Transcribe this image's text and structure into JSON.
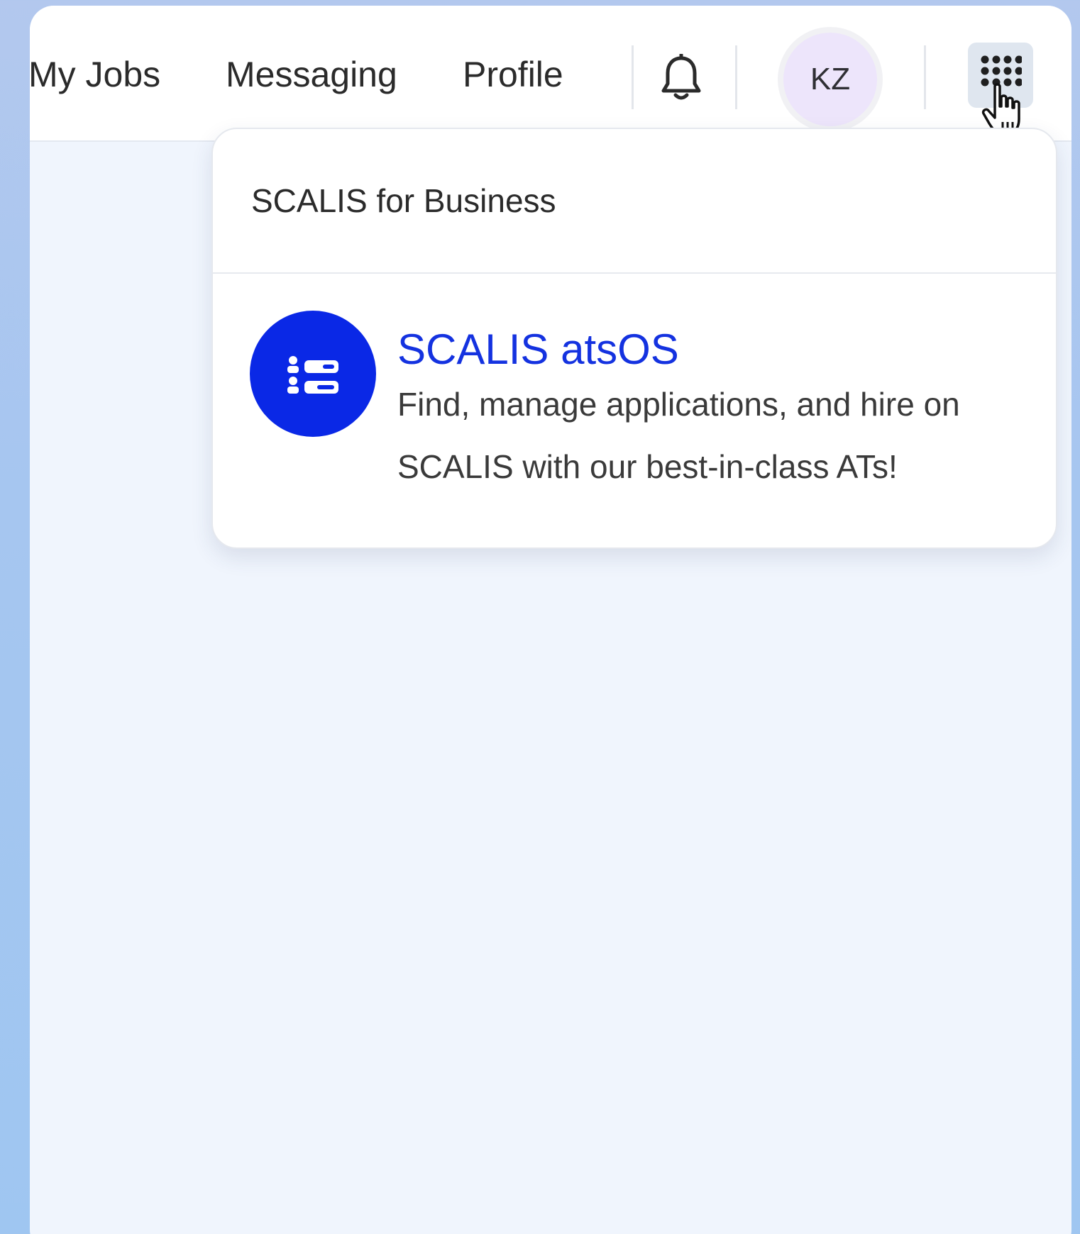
{
  "nav": {
    "items": [
      {
        "label": "My Jobs"
      },
      {
        "label": "Messaging"
      },
      {
        "label": "Profile"
      }
    ]
  },
  "user": {
    "initials": "KZ"
  },
  "icons": {
    "notifications": "bell-icon",
    "apps": "grid-dots-icon",
    "cursor": "hand-pointer-icon",
    "app": "list-users-icon"
  },
  "dropdown": {
    "title": "SCALIS for Business",
    "apps": [
      {
        "name": "SCALIS atsOS",
        "description": "Find, manage applications, and hire on SCALIS with our best-in-class ATs!"
      }
    ]
  },
  "colors": {
    "brand_blue": "#0a28e6",
    "link_blue": "#1432e0",
    "avatar_bg": "#ede5fb",
    "page_bg": "#f0f5fd"
  }
}
